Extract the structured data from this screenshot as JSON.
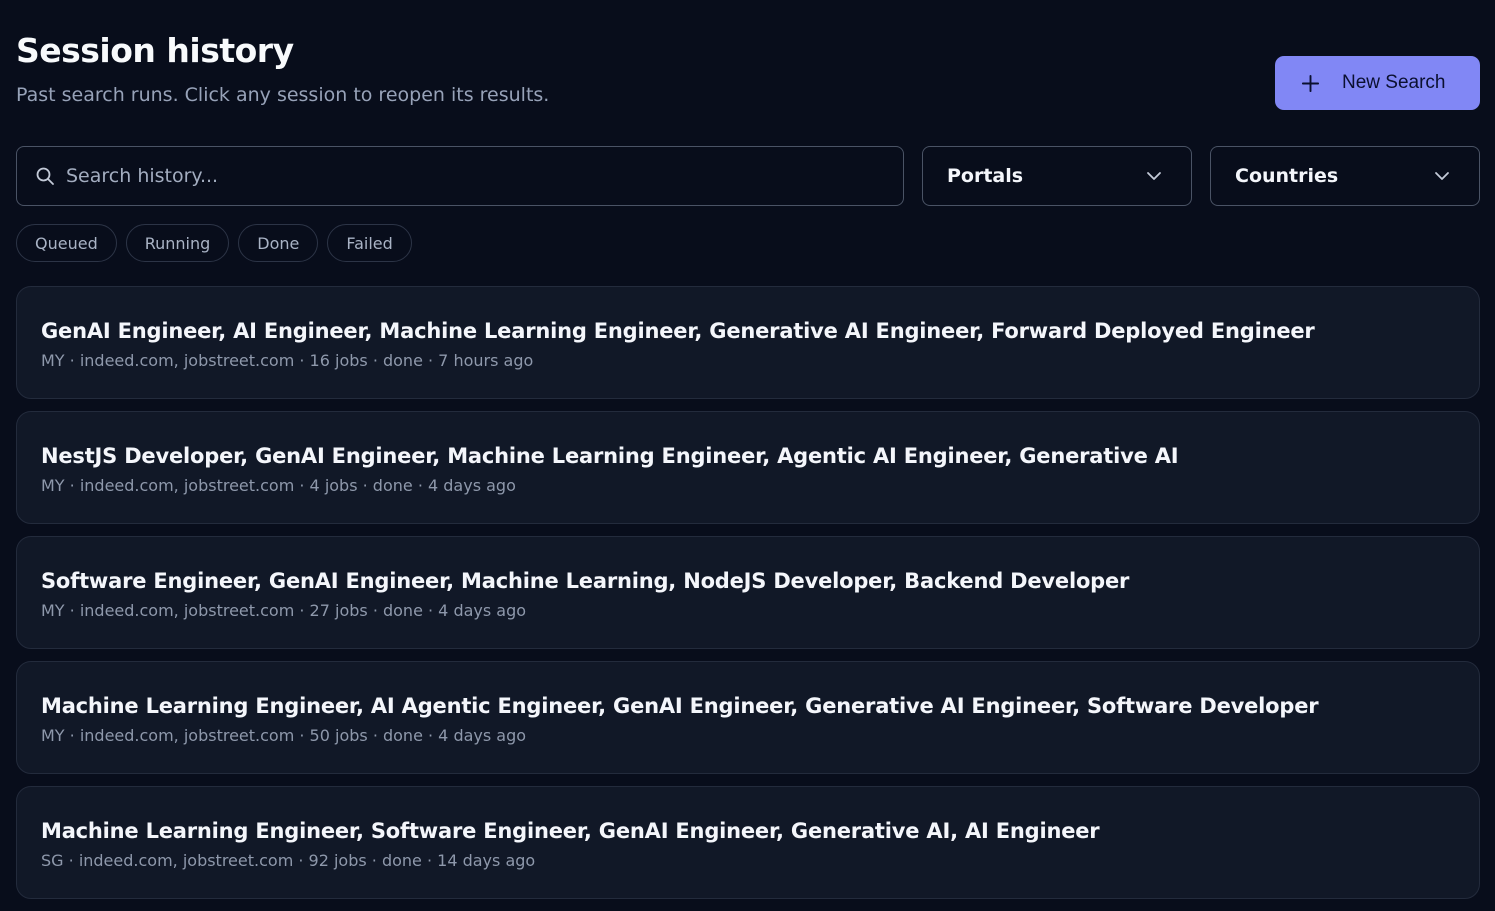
{
  "header": {
    "title": "Session history",
    "subtitle": "Past search runs. Click any session to reopen its results.",
    "new_search_label": "New Search",
    "new_search_icon": "plus-icon"
  },
  "filters": {
    "search_placeholder": "Search history...",
    "search_value": "",
    "search_icon": "search-icon",
    "portals_label": "Portals",
    "countries_label": "Countries",
    "status_chips": [
      "Queued",
      "Running",
      "Done",
      "Failed"
    ]
  },
  "colors": {
    "background": "#080d1b",
    "card": "#111827",
    "accent": "#8187f5"
  },
  "sessions": [
    {
      "title": "GenAI Engineer, AI Engineer, Machine Learning Engineer, Generative AI Engineer, Forward Deployed Engineer",
      "meta": "MY · indeed.com, jobstreet.com · 16 jobs · done · 7 hours ago"
    },
    {
      "title": "NestJS Developer, GenAI Engineer, Machine Learning Engineer, Agentic AI Engineer, Generative AI",
      "meta": "MY · indeed.com, jobstreet.com · 4 jobs · done · 4 days ago"
    },
    {
      "title": "Software Engineer, GenAI Engineer, Machine Learning, NodeJS Developer, Backend Developer",
      "meta": "MY · indeed.com, jobstreet.com · 27 jobs · done · 4 days ago"
    },
    {
      "title": "Machine Learning Engineer, AI Agentic Engineer, GenAI Engineer, Generative AI Engineer, Software Developer",
      "meta": "MY · indeed.com, jobstreet.com · 50 jobs · done · 4 days ago"
    },
    {
      "title": "Machine Learning Engineer, Software Engineer, GenAI Engineer, Generative AI, AI Engineer",
      "meta": "SG · indeed.com, jobstreet.com · 92 jobs · done · 14 days ago"
    }
  ]
}
